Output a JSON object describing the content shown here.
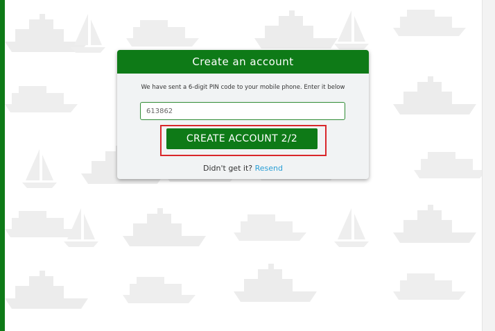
{
  "card": {
    "title": "Create an account",
    "message": "We have sent a 6-digit PIN code to your mobile phone. Enter it below",
    "pin_value": "613862",
    "button_label": "CREATE ACCOUNT 2/2",
    "resend_prompt": "Didn't get it?",
    "resend_link": "Resend"
  },
  "colors": {
    "brand_green": "#0e7a17",
    "highlight_red": "#d9262a",
    "link_blue": "#2a9fd6"
  },
  "icons": {
    "background": "ship-icon"
  }
}
